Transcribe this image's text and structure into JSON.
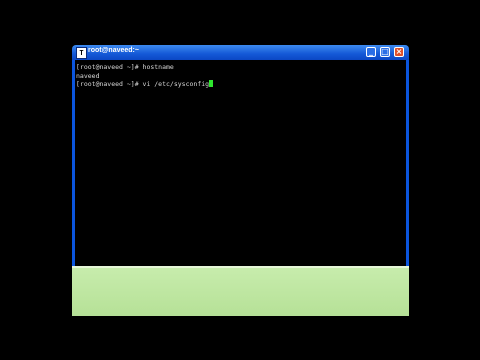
{
  "window": {
    "title": "root@naveed:~",
    "app_icon": "terminal-icon",
    "controls": {
      "minimize": "_",
      "maximize": "□",
      "close": "×"
    }
  },
  "terminal": {
    "lines": [
      "[root@naveed ~]# hostname",
      "naveed",
      "[root@naveed ~]# vi /etc/sysconfig"
    ],
    "cursor_color": "#2ee62e"
  },
  "colors": {
    "titlebar": "#1458d6",
    "background": "#000000",
    "panel": "#c0e8a3"
  }
}
